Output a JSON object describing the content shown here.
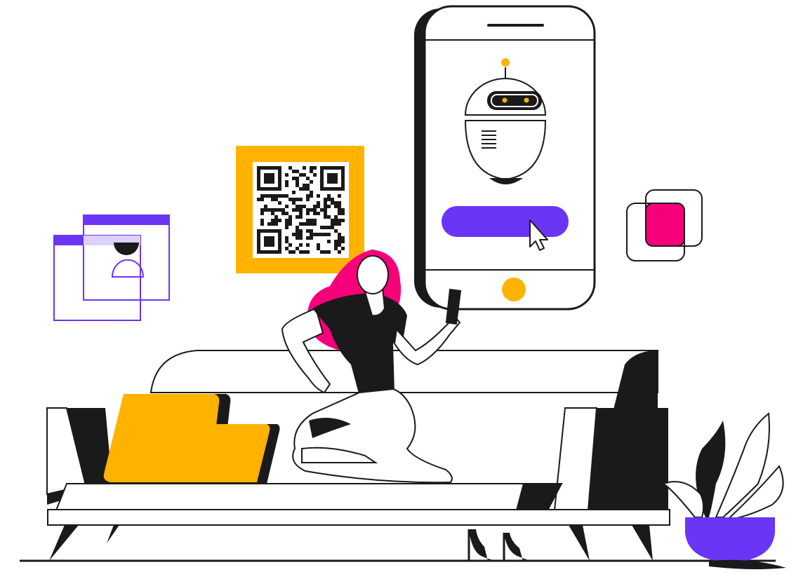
{
  "scene": {
    "description_icons": [
      "qr-code-icon",
      "chatbot-icon",
      "cursor-icon",
      "user-profile-icon",
      "app-window-icon",
      "layered-squares-icon",
      "smartphone-icon",
      "sofa-icon",
      "potted-plant-icon",
      "high-heels-icon"
    ]
  },
  "colors": {
    "accent_purple": "#6a35f5",
    "accent_yellow": "#ffb300",
    "accent_pink": "#f5007a",
    "ink": "#1a1a1a",
    "light_purple": "#dcd0ff",
    "background": "#ffffff"
  },
  "phone": {
    "button_label": ""
  }
}
